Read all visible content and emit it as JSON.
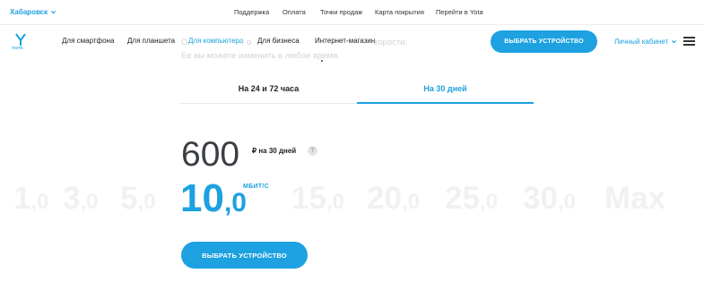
{
  "topbar": {
    "city": "Хабаровск",
    "links": [
      "Поддержка",
      "Оплата",
      "Точки продаж",
      "Карта покрытия",
      "Перейти в Yota"
    ]
  },
  "nav": {
    "logo_text": "YOTA",
    "items": [
      "Для смартфона",
      "Для планшета",
      "Для компьютера",
      "Для бизнеса",
      "Интернет-магазин"
    ],
    "active_item": "Для компьютера",
    "cta": "ВЫБРАТЬ УСТРОЙСТВО",
    "cabinet": "Личный кабинет"
  },
  "background_hint": {
    "line1_start": "О",
    "line1_mid": "т о",
    "line1_end": "корости.",
    "line2": "Ее вы можете изменить в любое время."
  },
  "tabs": [
    {
      "label": "На 24 и 72 часа",
      "active": false
    },
    {
      "label": "На 30 дней",
      "active": true
    }
  ],
  "price": {
    "value": "600",
    "unit": "₽ на 30 дней",
    "info_symbol": "?"
  },
  "speeds": [
    {
      "int": "1",
      "dec": ",0"
    },
    {
      "int": "3",
      "dec": ",0"
    },
    {
      "int": "5",
      "dec": ",0"
    },
    {
      "int": "10",
      "dec": ",0"
    },
    {
      "int": "15",
      "dec": ",0"
    },
    {
      "int": "20",
      "dec": ",0"
    },
    {
      "int": "25",
      "dec": ",0"
    },
    {
      "int": "30",
      "dec": ",0"
    },
    {
      "int": "Max",
      "dec": ""
    }
  ],
  "speed_selected": "10,0",
  "speed_unit": "МБИТ/С",
  "main_cta": "ВЫБРАТЬ УСТРОЙСТВО",
  "colors": {
    "accent": "#1da1e0",
    "text": "#222222",
    "muted_scale": "#f0f1f3"
  },
  "icons": [
    "chevron-down-icon",
    "yota-logo-icon",
    "menu-icon",
    "info-icon"
  ]
}
